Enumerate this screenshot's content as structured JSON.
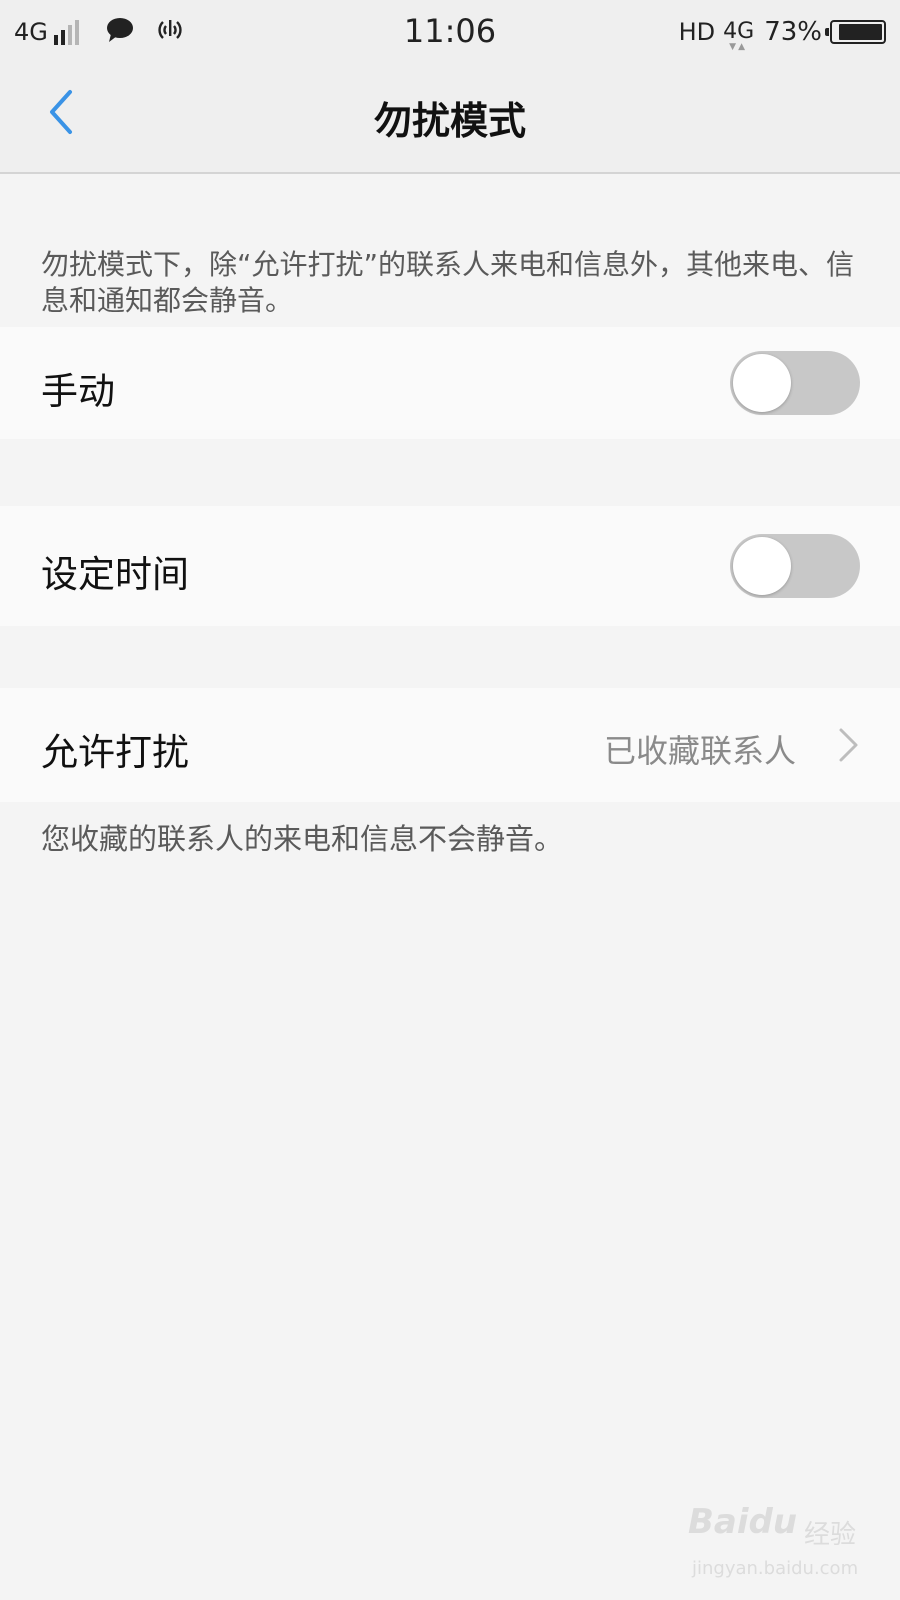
{
  "status_bar": {
    "network_left": "4G",
    "time": "11:06",
    "hd": "HD",
    "network_right": "4G",
    "battery": "73%",
    "icons": [
      "signal-icon",
      "message-icon",
      "hotspot-icon",
      "battery-icon"
    ]
  },
  "nav": {
    "title": "勿扰模式",
    "back_icon": "chevron-left-icon"
  },
  "intro": "勿扰模式下，除“允许打扰”的联系人来电和信息外，其他来电、信息和通知都会静音。",
  "settings": {
    "manual": {
      "label": "手动",
      "enabled": false
    },
    "scheduled": {
      "label": "设定时间",
      "enabled": false
    },
    "allow": {
      "label": "允许打扰",
      "value": "已收藏联系人",
      "icon": "chevron-right-icon"
    }
  },
  "footnote": "您收藏的联系人的来电和信息不会静音。",
  "watermark": {
    "logo": "Baidu",
    "label": "经验",
    "url": "jingyan.baidu.com"
  },
  "colors": {
    "accent": "#3a93e6",
    "toggle_off": "#c8c8c8",
    "background": "#f4f4f4",
    "row_background": "#fafafa"
  }
}
